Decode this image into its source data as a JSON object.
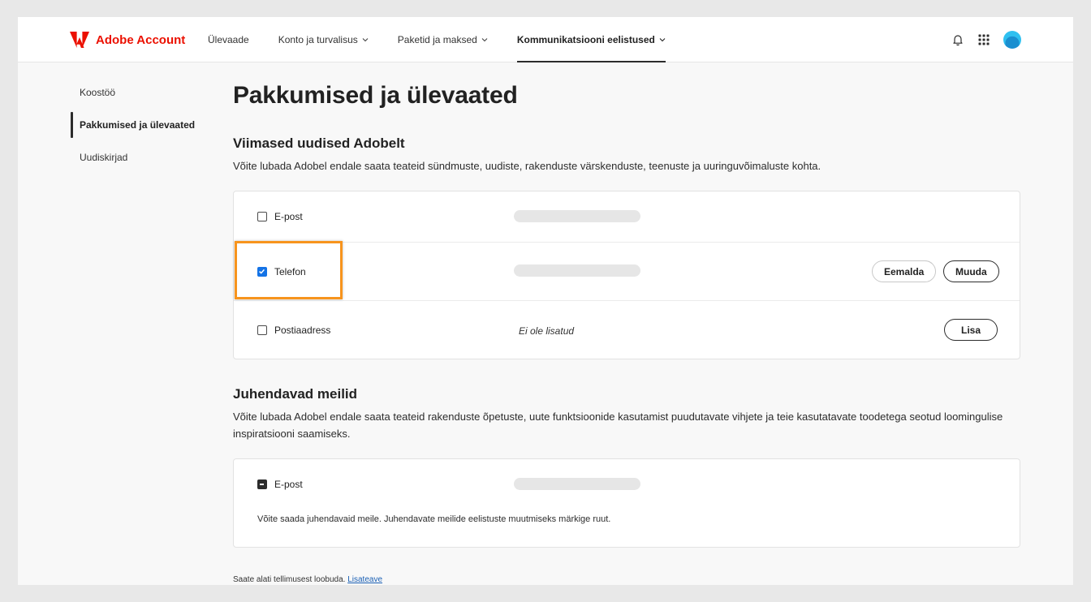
{
  "header": {
    "brand": "Adobe Account",
    "nav": [
      {
        "label": "Ülevaade",
        "has_dropdown": false,
        "active": false
      },
      {
        "label": "Konto ja turvalisus",
        "has_dropdown": true,
        "active": false
      },
      {
        "label": "Paketid ja maksed",
        "has_dropdown": true,
        "active": false
      },
      {
        "label": "Kommunikatsiooni eelistused",
        "has_dropdown": true,
        "active": true
      }
    ],
    "icons": [
      "bell-icon",
      "apps-grid-icon",
      "avatar"
    ]
  },
  "sidebar": {
    "items": [
      {
        "label": "Koostöö",
        "active": false
      },
      {
        "label": "Pakkumised ja ülevaated",
        "active": true
      },
      {
        "label": "Uudiskirjad",
        "active": false
      }
    ]
  },
  "main": {
    "title": "Pakkumised ja ülevaated",
    "news": {
      "title": "Viimased uudised Adobelt",
      "description": "Võite lubada Adobel endale saata teateid sündmuste, uudiste, rakenduste värskenduste, teenuste ja uuringuvõimaluste kohta.",
      "rows": [
        {
          "label": "E-post",
          "checked": false
        },
        {
          "label": "Telefon",
          "checked": true,
          "remove_label": "Eemalda",
          "edit_label": "Muuda"
        },
        {
          "label": "Postiaadress",
          "checked": false,
          "value": "Ei ole lisatud",
          "add_label": "Lisa"
        }
      ]
    },
    "guides": {
      "title": "Juhendavad meilid",
      "description": "Võite lubada Adobel endale saata teateid rakenduste õpetuste, uute funktsioonide kasutamist puudutavate vihjete ja teie kasutatavate toodetega seotud loomingulise inspiratsiooni saamiseks.",
      "email_label": "E-post",
      "email_state": "indeterminate",
      "note": "Võite saada juhendavaid meile. Juhendavate meilide eelistuste muutmiseks märkige ruut."
    },
    "footer": {
      "text": "Saate alati tellimusest loobuda.",
      "link": "Lisateave"
    }
  },
  "colors": {
    "brand_red": "#eb1000",
    "checkbox_blue": "#1473e6",
    "highlight_orange": "#f7941d"
  }
}
